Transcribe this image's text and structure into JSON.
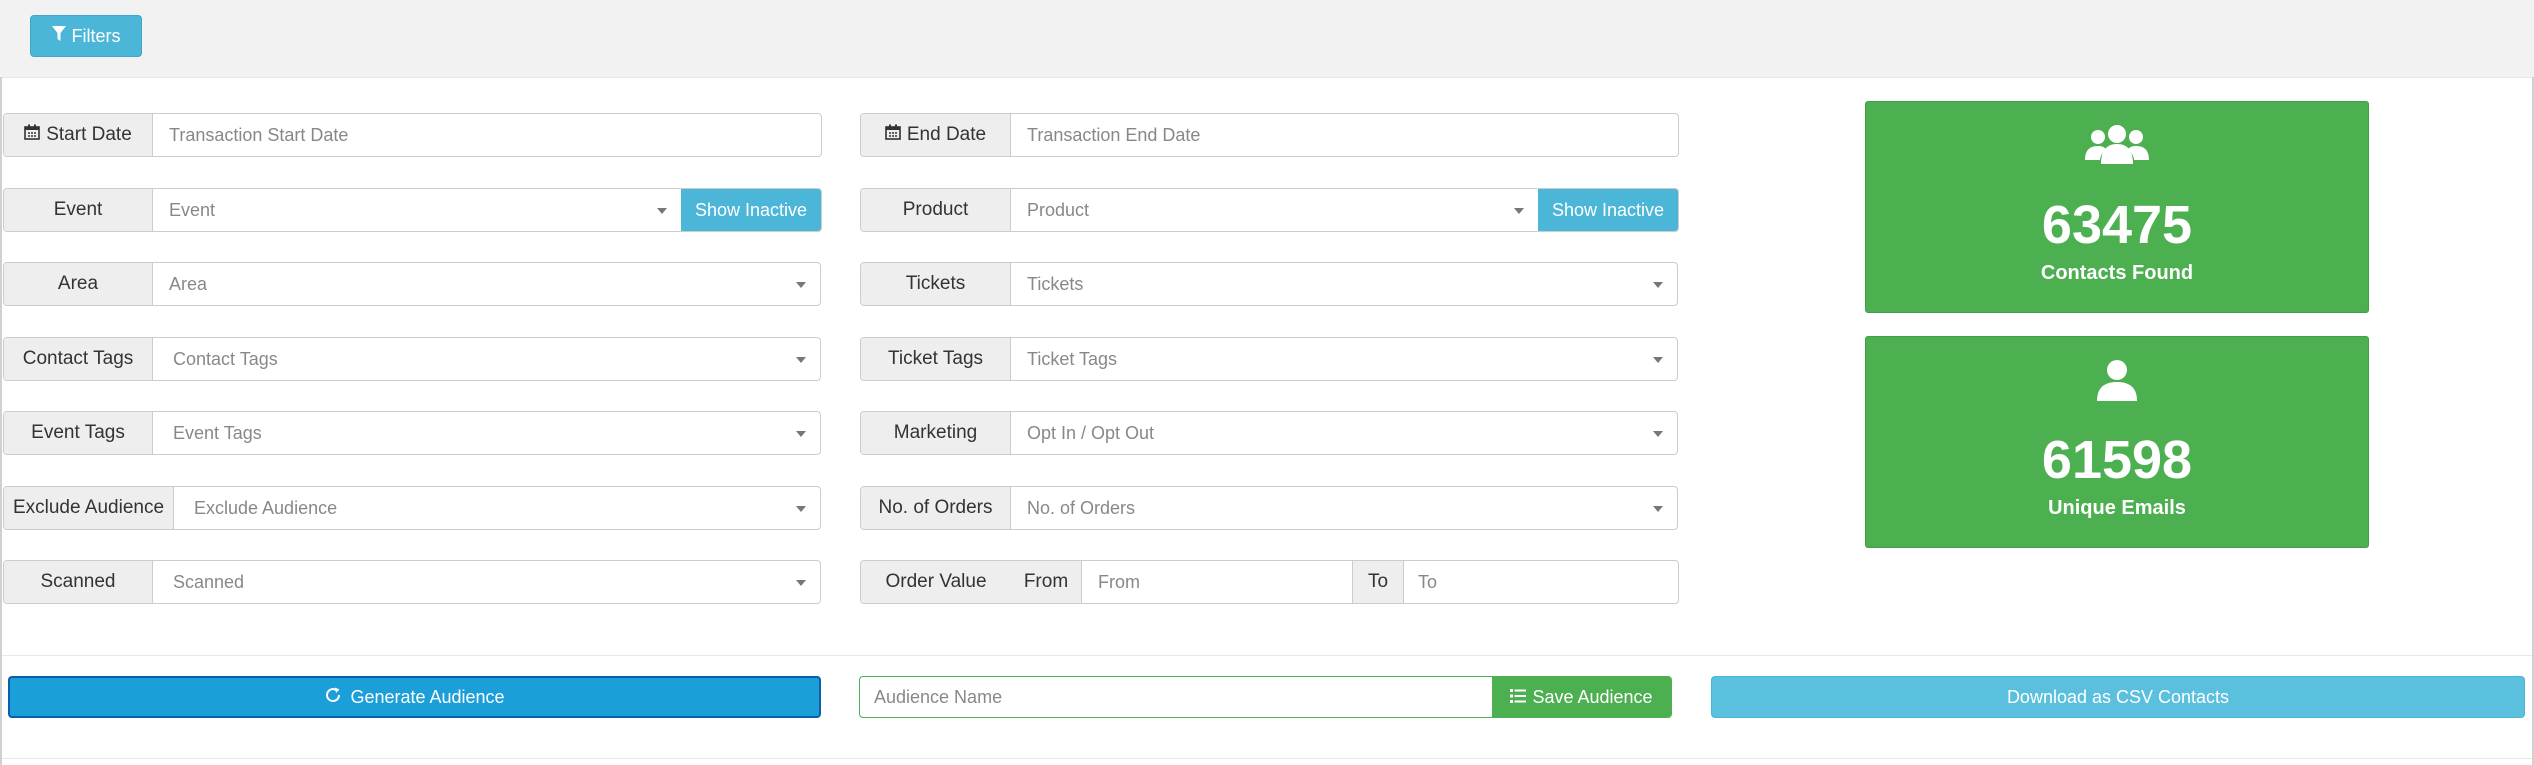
{
  "toolbar": {
    "filters_label": "Filters"
  },
  "filters": {
    "start_date": {
      "label": "Start Date",
      "placeholder": "Transaction Start Date"
    },
    "end_date": {
      "label": "End Date",
      "placeholder": "Transaction End Date"
    },
    "event": {
      "label": "Event",
      "placeholder": "Event",
      "show_inactive": "Show Inactive"
    },
    "product": {
      "label": "Product",
      "placeholder": "Product",
      "show_inactive": "Show Inactive"
    },
    "area": {
      "label": "Area",
      "placeholder": "Area"
    },
    "tickets": {
      "label": "Tickets",
      "placeholder": "Tickets"
    },
    "contact_tags": {
      "label": "Contact Tags",
      "placeholder": "Contact Tags"
    },
    "ticket_tags": {
      "label": "Ticket Tags",
      "placeholder": "Ticket Tags"
    },
    "event_tags": {
      "label": "Event Tags",
      "placeholder": "Event Tags"
    },
    "marketing": {
      "label": "Marketing",
      "placeholder": "Opt In / Opt Out"
    },
    "exclude_audience": {
      "label": "Exclude Audience",
      "placeholder": "Exclude Audience"
    },
    "no_of_orders": {
      "label": "No. of Orders",
      "placeholder": "No. of Orders"
    },
    "scanned": {
      "label": "Scanned",
      "placeholder": "Scanned"
    },
    "order_value": {
      "label": "Order Value",
      "from_label": "From",
      "from_placeholder": "From",
      "to_label": "To",
      "to_placeholder": "To"
    }
  },
  "stats": {
    "contacts": {
      "value": "63475",
      "label": "Contacts Found",
      "icon": "users-icon"
    },
    "emails": {
      "value": "61598",
      "label": "Unique Emails",
      "icon": "user-icon"
    }
  },
  "actions": {
    "generate_label": "Generate Audience",
    "audience_name_placeholder": "Audience Name",
    "save_label": "Save Audience",
    "download_label": "Download as CSV Contacts"
  },
  "colors": {
    "info": "#4cb6d9",
    "success": "#4caf50",
    "primary": "#1a9fd9"
  }
}
